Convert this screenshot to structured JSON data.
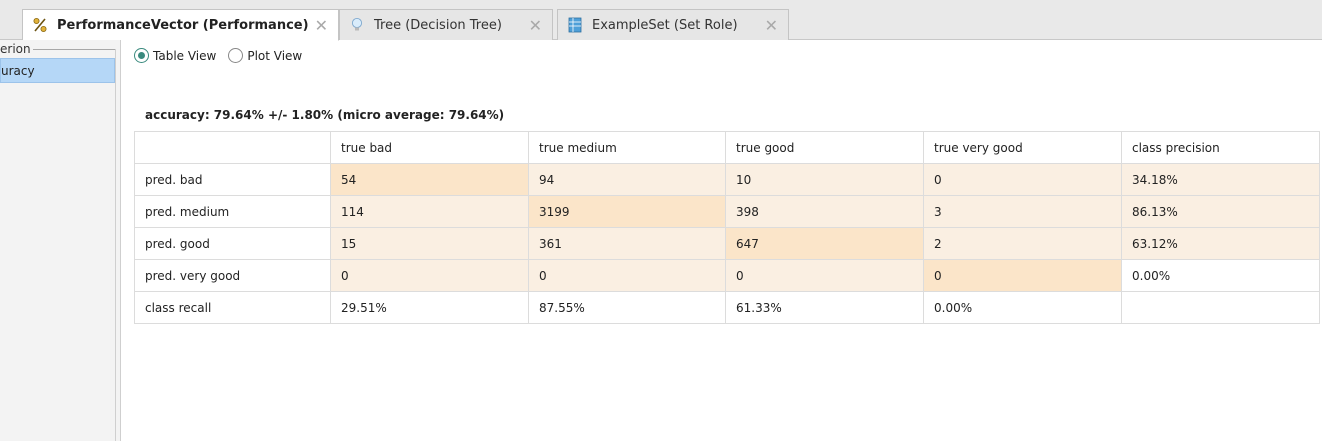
{
  "tabs": [
    {
      "label": "PerformanceVector (Performance)",
      "icon": "percent-icon",
      "active": true
    },
    {
      "label": "Tree (Decision Tree)",
      "icon": "lightbulb-icon",
      "active": false
    },
    {
      "label": "ExampleSet (Set Role)",
      "icon": "table-icon",
      "active": false
    }
  ],
  "tab_close_glyph": "✕",
  "left_pane": {
    "group_label": "erion",
    "selected_item": "uracy"
  },
  "view_toggle": {
    "table_label": "Table View",
    "plot_label": "Plot View",
    "selected": "Table View"
  },
  "accuracy_text": "accuracy: 79.64% +/- 1.80% (micro average: 79.64%)",
  "table": {
    "headers": [
      "",
      "true bad",
      "true medium",
      "true good",
      "true very good",
      "class precision"
    ],
    "rows": [
      {
        "label": "pred. bad",
        "cells": [
          "54",
          "94",
          "10",
          "0"
        ],
        "precision": "34.18%"
      },
      {
        "label": "pred. medium",
        "cells": [
          "114",
          "3199",
          "398",
          "3"
        ],
        "precision": "86.13%"
      },
      {
        "label": "pred. good",
        "cells": [
          "15",
          "361",
          "647",
          "2"
        ],
        "precision": "63.12%"
      },
      {
        "label": "pred. very good",
        "cells": [
          "0",
          "0",
          "0",
          "0"
        ],
        "precision": "0.00%"
      }
    ],
    "recall": {
      "label": "class recall",
      "cells": [
        "29.51%",
        "87.55%",
        "61.33%",
        "0.00%"
      ]
    }
  },
  "colors": {
    "diagonal": "#fbe5c9",
    "off_diagonal": "#faefe2",
    "selection": "#b5d7f7",
    "radio_accent": "#3a8a7e"
  }
}
